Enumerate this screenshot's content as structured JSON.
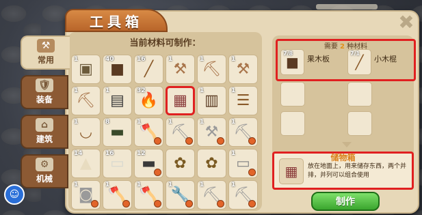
{
  "window": {
    "title": "工具箱",
    "close_label": "✖"
  },
  "sidebar": {
    "tabs": [
      {
        "label": "常用",
        "icon": "hammer-icon",
        "glyph": "⚒",
        "active": true
      },
      {
        "label": "装备",
        "icon": "armor-icon",
        "glyph": "🛡",
        "active": false
      },
      {
        "label": "建筑",
        "icon": "house-icon",
        "glyph": "⌂",
        "active": false
      },
      {
        "label": "机械",
        "icon": "gear-icon",
        "glyph": "⚙",
        "active": false
      }
    ]
  },
  "craft_list": {
    "heading": "当前材料可制作：",
    "items": [
      {
        "num": "1",
        "icon": "wood-block-icon",
        "glyph": "▣",
        "color": "#6b5a3a",
        "lock": false
      },
      {
        "num": "40",
        "icon": "wood-block-icon",
        "glyph": "■",
        "color": "#5a3a22",
        "lock": false
      },
      {
        "num": "16",
        "icon": "stick-icon",
        "glyph": "╱",
        "color": "#8a5a2a",
        "lock": false
      },
      {
        "num": "1",
        "icon": "shovel-icon",
        "glyph": "⚒",
        "color": "#a8744a",
        "lock": false
      },
      {
        "num": "1",
        "icon": "pickaxe-icon",
        "glyph": "⛏",
        "color": "#a8744a",
        "lock": false
      },
      {
        "num": "1",
        "icon": "shovel-icon",
        "glyph": "⚒",
        "color": "#a8744a",
        "lock": false
      },
      {
        "num": "1",
        "icon": "hoe-icon",
        "glyph": "⛏",
        "color": "#a8744a",
        "lock": false
      },
      {
        "num": "1",
        "icon": "furnace-icon",
        "glyph": "▤",
        "color": "#3a3a3a",
        "lock": false
      },
      {
        "num": "32",
        "icon": "torch-icon",
        "glyph": "🔥",
        "color": "#e08a1a",
        "lock": false
      },
      {
        "num": "",
        "icon": "storage-box-icon",
        "glyph": "▦",
        "color": "#8a3a3a",
        "lock": false,
        "selected": true
      },
      {
        "num": "1",
        "icon": "door-icon",
        "glyph": "▥",
        "color": "#5a3a22",
        "lock": false
      },
      {
        "num": "1",
        "icon": "ladder-icon",
        "glyph": "☰",
        "color": "#8a5a2a",
        "lock": false
      },
      {
        "num": "1",
        "icon": "bowl-icon",
        "glyph": "◡",
        "color": "#8a5a2a",
        "lock": false
      },
      {
        "num": "8",
        "icon": "sign-icon",
        "glyph": "▬",
        "color": "#3a4a2a",
        "lock": false
      },
      {
        "num": "1",
        "icon": "axe-icon",
        "glyph": "🪓",
        "color": "#9a9a9a",
        "lock": true
      },
      {
        "num": "1",
        "icon": "pickaxe-icon",
        "glyph": "⛏",
        "color": "#9a9a9a",
        "lock": true
      },
      {
        "num": "1",
        "icon": "shovel-icon",
        "glyph": "⚒",
        "color": "#9a9a9a",
        "lock": true
      },
      {
        "num": "1",
        "icon": "hoe-icon",
        "glyph": "⛏",
        "color": "#9a9a9a",
        "lock": true
      },
      {
        "num": "14",
        "icon": "sand-pile-icon",
        "glyph": "▲",
        "color": "#e8dcc0",
        "lock": false
      },
      {
        "num": "16",
        "icon": "paper-icon",
        "glyph": "▭",
        "color": "#d8d8d0",
        "lock": false
      },
      {
        "num": "12",
        "icon": "tablet-icon",
        "glyph": "▬",
        "color": "#3a3a3a",
        "lock": true
      },
      {
        "num": "",
        "icon": "seed-bag-icon",
        "glyph": "✿",
        "color": "#7a5a22",
        "lock": false
      },
      {
        "num": "",
        "icon": "seed-bag-icon",
        "glyph": "✿",
        "color": "#7a5a22",
        "lock": false
      },
      {
        "num": "1",
        "icon": "bed-icon",
        "glyph": "▭",
        "color": "#8a8a8a",
        "lock": true
      },
      {
        "num": "1",
        "icon": "bucket-icon",
        "glyph": "◙",
        "color": "#9a9a9a",
        "lock": true
      },
      {
        "num": "1",
        "icon": "axe-icon",
        "glyph": "🪓",
        "color": "#9a9a9a",
        "lock": true
      },
      {
        "num": "1",
        "icon": "axe-icon",
        "glyph": "🪓",
        "color": "#9a9a9a",
        "lock": true
      },
      {
        "num": "1",
        "icon": "wrench-icon",
        "glyph": "🔧",
        "color": "#9a9a9a",
        "lock": true
      },
      {
        "num": "1",
        "icon": "pickaxe-icon",
        "glyph": "⛏",
        "color": "#9a9a9a",
        "lock": true
      },
      {
        "num": "1",
        "icon": "pickaxe-icon",
        "glyph": "⛏",
        "color": "#9a9a9a",
        "lock": true
      }
    ]
  },
  "materials": {
    "prefix": "需要",
    "count": "2",
    "suffix": "种材料",
    "items": [
      {
        "num": "7/8",
        "name": "果木板",
        "icon": "fruitwood-plank-icon",
        "glyph": "■",
        "color": "#5a3a22"
      },
      {
        "num": "7/1",
        "name": "小木棍",
        "icon": "small-stick-icon",
        "glyph": "╱",
        "color": "#8a5a2a"
      }
    ]
  },
  "result": {
    "title": "储物箱",
    "icon": "storage-box-icon",
    "glyph": "▦",
    "color": "#8a3a3a",
    "description": "放在地面上，用来储存东西，两个并排，并列可以组合使用"
  },
  "make_button": {
    "label": "制作"
  },
  "avatar": {
    "glyph": "☺"
  }
}
